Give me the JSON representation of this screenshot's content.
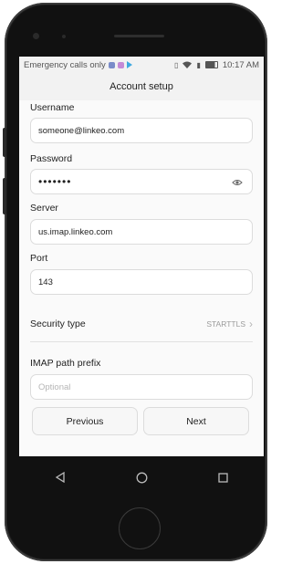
{
  "status_bar": {
    "left_text": "Emergency calls only",
    "time": "10:17 AM",
    "icons": [
      "sim-icon",
      "notification-icon",
      "play-icon",
      "vibrate-icon",
      "wifi-icon",
      "data-icon",
      "battery-icon"
    ]
  },
  "header": {
    "title": "Account setup"
  },
  "form": {
    "username_label": "Username",
    "username_value": "someone@linkeo.com",
    "password_label": "Password",
    "password_value": "•••••••",
    "server_label": "Server",
    "server_value": "us.imap.linkeo.com",
    "port_label": "Port",
    "port_value": "143",
    "security_label": "Security type",
    "security_value": "STARTTLS",
    "prefix_label": "IMAP path prefix",
    "prefix_placeholder": "Optional"
  },
  "buttons": {
    "previous": "Previous",
    "next": "Next"
  },
  "nav": {
    "icons": [
      "back-icon",
      "home-icon",
      "recents-icon"
    ]
  },
  "colors": {
    "screen_bg": "#f2f2f2",
    "field_border": "#dcdcdc",
    "phone_body": "#1b1b1b"
  }
}
